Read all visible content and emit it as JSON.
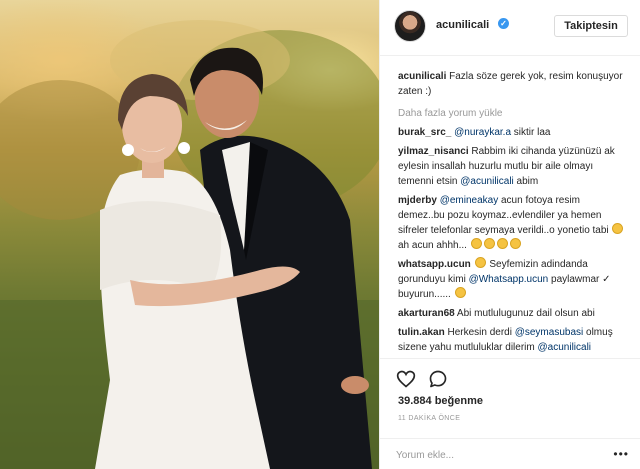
{
  "post": {
    "username": "acunilicali",
    "follow_label": "Takiptesin",
    "caption_user": "acunilicali",
    "caption_text": "Fazla söze gerek yok, resim konuşuyor zaten :)",
    "load_more": "Daha fazla yorum yükle",
    "likes": "39.884 beğenme",
    "time": "11 DAKİKA ÖNCE",
    "comment_placeholder": "Yorum ekle...",
    "more_label": "•••"
  },
  "comments": [
    {
      "user": "burak_src_",
      "mention": "@nuraykar.a",
      "text": " siktir laa",
      "emojis": 0
    },
    {
      "user": "yilmaz_nisanci",
      "text": "Rabbim iki cihanda yüzünüzü ak eylesin insallah huzurlu mutlu bir aile olmayı temenni etsin ",
      "mention2": "@acunilicali",
      "text2": " abim",
      "emojis": 0
    },
    {
      "user": "mjderby",
      "mention": "@emineakay",
      "text": " acun fotoya resim demez..bu pozu koymaz..evlendiler ya hemen sifreler telefonlar seymaya verildi..o yonetio tabi",
      "text2": " ah acun ahhh...",
      "emojis": 5
    },
    {
      "user": "whatsapp.ucun",
      "text": " Seyfemizin adindanda gorunduyu kimi ",
      "mention2": "@Whatsapp.ucun",
      "text2": " paylawmar ✓ buyurun......",
      "emojis": 1
    },
    {
      "user": "akarturan68",
      "text": " Abi mutlulugunuz dail olsun abi",
      "emojis": 0
    },
    {
      "user": "tulin.akan",
      "text": " Herkesin derdi ",
      "mention2": "@seymasubasi",
      "text2": " olmuş sizene yahu mutluluklar dilerim ",
      "mention3": "@acunilicali",
      "emojis": 0
    }
  ],
  "icons": {
    "heart": "heart-icon",
    "comment": "comment-bubble-icon",
    "verified": "verified-badge-icon",
    "emoji": "face-emoji-icon"
  },
  "colors": {
    "mention": "#003569",
    "verified": "#3897f0",
    "muted": "#999999"
  }
}
